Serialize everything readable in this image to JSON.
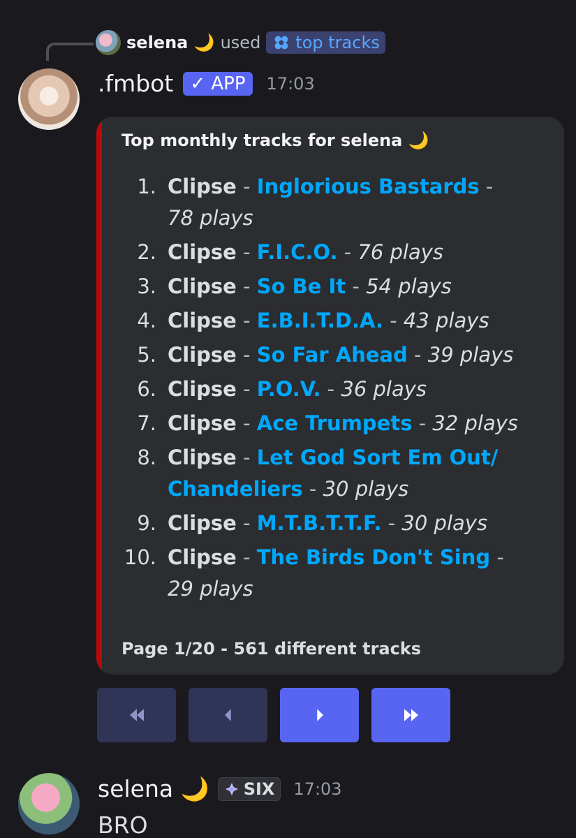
{
  "reply": {
    "username": "selena 🌙",
    "used_text": "used",
    "command": "top tracks",
    "command_icon": "command-sparkle-icon"
  },
  "bot": {
    "name": ".fmbot",
    "badge": "✓ APP",
    "time": "17:03"
  },
  "embed": {
    "accent_color": "#b80a0a",
    "title": "Top monthly tracks for selena 🌙",
    "tracks": [
      {
        "num": "1.",
        "artist": "Clipse",
        "song": "Inglorious Bastards",
        "plays": "78 plays"
      },
      {
        "num": "2.",
        "artist": "Clipse",
        "song": "F.I.C.O.",
        "plays": "76 plays"
      },
      {
        "num": "3.",
        "artist": "Clipse",
        "song": "So Be It",
        "plays": "54 plays"
      },
      {
        "num": "4.",
        "artist": "Clipse",
        "song": "E.B.I.T.D.A.",
        "plays": "43 plays"
      },
      {
        "num": "5.",
        "artist": "Clipse",
        "song": "So Far Ahead",
        "plays": "39 plays"
      },
      {
        "num": "6.",
        "artist": "Clipse",
        "song": "P.O.V.",
        "plays": "36 plays"
      },
      {
        "num": "7.",
        "artist": "Clipse",
        "song": "Ace Trumpets",
        "plays": "32 plays"
      },
      {
        "num": "8.",
        "artist": "Clipse",
        "song": "Let God Sort Em Out/ Chandeliers",
        "plays": "30 plays"
      },
      {
        "num": "9.",
        "artist": "Clipse",
        "song": "M.T.B.T.T.F.",
        "plays": "30 plays"
      },
      {
        "num": "10.",
        "artist": "Clipse",
        "song": "The Birds Don't Sing",
        "plays": "29 plays"
      }
    ],
    "footer": "Page 1/20 - 561 different tracks"
  },
  "buttons": [
    {
      "name": "first-page-button",
      "icon": "double-chevron-left-icon",
      "enabled": false
    },
    {
      "name": "previous-page-button",
      "icon": "chevron-left-icon",
      "enabled": false
    },
    {
      "name": "next-page-button",
      "icon": "chevron-right-icon",
      "enabled": true
    },
    {
      "name": "last-page-button",
      "icon": "double-chevron-right-icon",
      "enabled": true
    }
  ],
  "message": {
    "username": "selena 🌙",
    "badge": "SIX",
    "badge_icon": "guild-tag-icon",
    "time": "17:03",
    "text": "BRO"
  },
  "colors": {
    "background": "#1a1a1e",
    "embed_bg": "#2b2d31",
    "link": "#00a8fc",
    "blurple": "#5865f2"
  }
}
